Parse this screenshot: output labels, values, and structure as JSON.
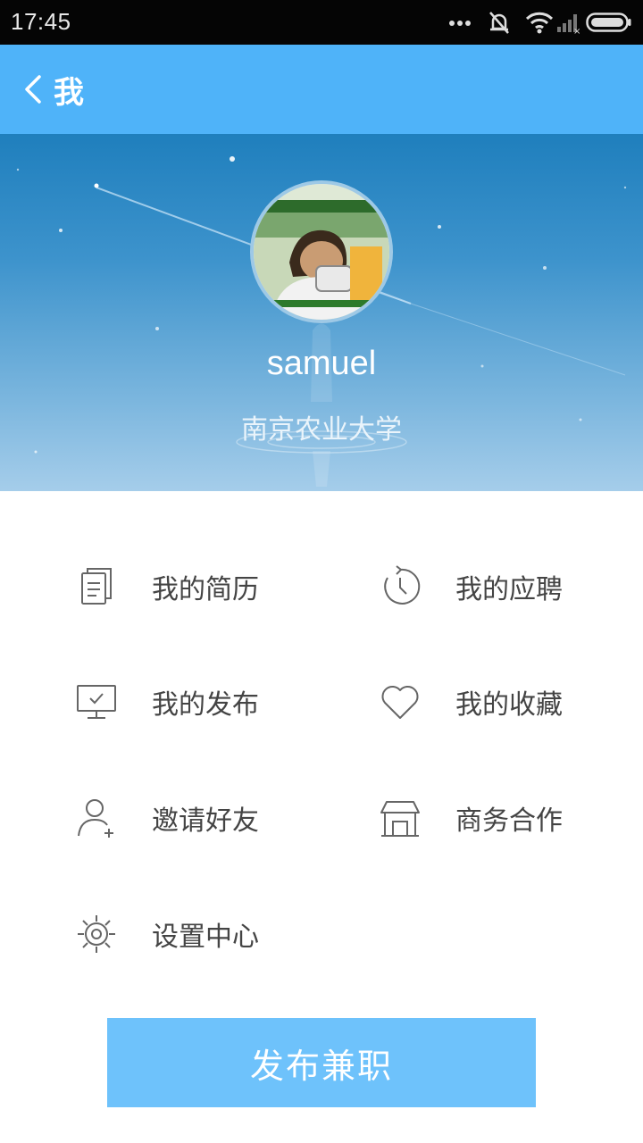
{
  "status_bar": {
    "time": "17:45"
  },
  "header": {
    "title": "我"
  },
  "profile": {
    "username": "samuel",
    "school": "南京农业大学"
  },
  "menu": [
    {
      "label": "我的简历",
      "icon": "resume-icon"
    },
    {
      "label": "我的应聘",
      "icon": "history-clock-icon"
    },
    {
      "label": "我的发布",
      "icon": "monitor-check-icon"
    },
    {
      "label": "我的收藏",
      "icon": "heart-icon"
    },
    {
      "label": "邀请好友",
      "icon": "add-user-icon"
    },
    {
      "label": "商务合作",
      "icon": "shop-icon"
    },
    {
      "label": "设置中心",
      "icon": "gear-icon"
    }
  ],
  "publish_button": {
    "label": "发布兼职"
  },
  "colors": {
    "header": "#4fb3f9",
    "button": "#6ec2fb",
    "icon_stroke": "#666666",
    "label_text": "#444444"
  }
}
